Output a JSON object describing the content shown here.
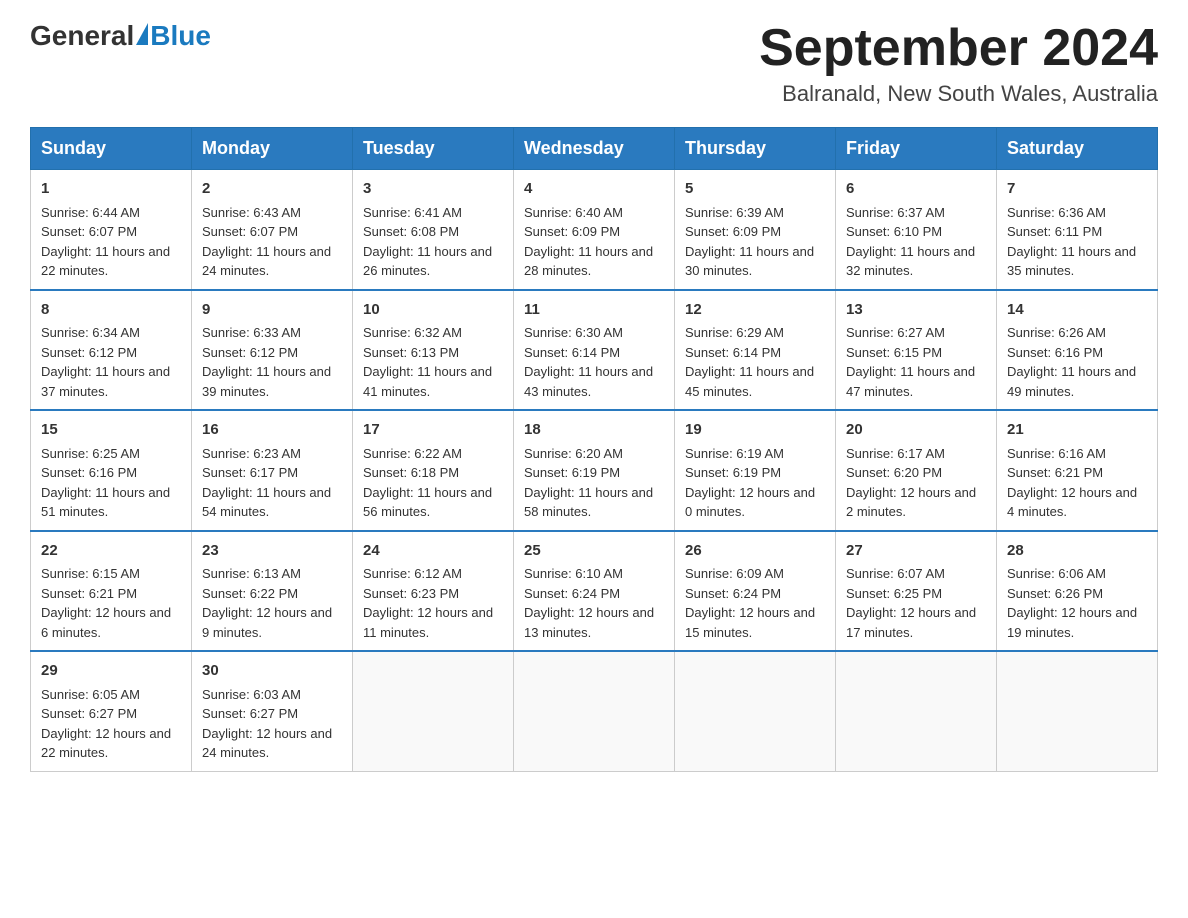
{
  "header": {
    "logo_general": "General",
    "logo_blue": "Blue",
    "month_title": "September 2024",
    "location": "Balranald, New South Wales, Australia"
  },
  "days_of_week": [
    "Sunday",
    "Monday",
    "Tuesday",
    "Wednesday",
    "Thursday",
    "Friday",
    "Saturday"
  ],
  "weeks": [
    [
      {
        "day": "1",
        "sunrise": "6:44 AM",
        "sunset": "6:07 PM",
        "daylight": "11 hours and 22 minutes."
      },
      {
        "day": "2",
        "sunrise": "6:43 AM",
        "sunset": "6:07 PM",
        "daylight": "11 hours and 24 minutes."
      },
      {
        "day": "3",
        "sunrise": "6:41 AM",
        "sunset": "6:08 PM",
        "daylight": "11 hours and 26 minutes."
      },
      {
        "day": "4",
        "sunrise": "6:40 AM",
        "sunset": "6:09 PM",
        "daylight": "11 hours and 28 minutes."
      },
      {
        "day": "5",
        "sunrise": "6:39 AM",
        "sunset": "6:09 PM",
        "daylight": "11 hours and 30 minutes."
      },
      {
        "day": "6",
        "sunrise": "6:37 AM",
        "sunset": "6:10 PM",
        "daylight": "11 hours and 32 minutes."
      },
      {
        "day": "7",
        "sunrise": "6:36 AM",
        "sunset": "6:11 PM",
        "daylight": "11 hours and 35 minutes."
      }
    ],
    [
      {
        "day": "8",
        "sunrise": "6:34 AM",
        "sunset": "6:12 PM",
        "daylight": "11 hours and 37 minutes."
      },
      {
        "day": "9",
        "sunrise": "6:33 AM",
        "sunset": "6:12 PM",
        "daylight": "11 hours and 39 minutes."
      },
      {
        "day": "10",
        "sunrise": "6:32 AM",
        "sunset": "6:13 PM",
        "daylight": "11 hours and 41 minutes."
      },
      {
        "day": "11",
        "sunrise": "6:30 AM",
        "sunset": "6:14 PM",
        "daylight": "11 hours and 43 minutes."
      },
      {
        "day": "12",
        "sunrise": "6:29 AM",
        "sunset": "6:14 PM",
        "daylight": "11 hours and 45 minutes."
      },
      {
        "day": "13",
        "sunrise": "6:27 AM",
        "sunset": "6:15 PM",
        "daylight": "11 hours and 47 minutes."
      },
      {
        "day": "14",
        "sunrise": "6:26 AM",
        "sunset": "6:16 PM",
        "daylight": "11 hours and 49 minutes."
      }
    ],
    [
      {
        "day": "15",
        "sunrise": "6:25 AM",
        "sunset": "6:16 PM",
        "daylight": "11 hours and 51 minutes."
      },
      {
        "day": "16",
        "sunrise": "6:23 AM",
        "sunset": "6:17 PM",
        "daylight": "11 hours and 54 minutes."
      },
      {
        "day": "17",
        "sunrise": "6:22 AM",
        "sunset": "6:18 PM",
        "daylight": "11 hours and 56 minutes."
      },
      {
        "day": "18",
        "sunrise": "6:20 AM",
        "sunset": "6:19 PM",
        "daylight": "11 hours and 58 minutes."
      },
      {
        "day": "19",
        "sunrise": "6:19 AM",
        "sunset": "6:19 PM",
        "daylight": "12 hours and 0 minutes."
      },
      {
        "day": "20",
        "sunrise": "6:17 AM",
        "sunset": "6:20 PM",
        "daylight": "12 hours and 2 minutes."
      },
      {
        "day": "21",
        "sunrise": "6:16 AM",
        "sunset": "6:21 PM",
        "daylight": "12 hours and 4 minutes."
      }
    ],
    [
      {
        "day": "22",
        "sunrise": "6:15 AM",
        "sunset": "6:21 PM",
        "daylight": "12 hours and 6 minutes."
      },
      {
        "day": "23",
        "sunrise": "6:13 AM",
        "sunset": "6:22 PM",
        "daylight": "12 hours and 9 minutes."
      },
      {
        "day": "24",
        "sunrise": "6:12 AM",
        "sunset": "6:23 PM",
        "daylight": "12 hours and 11 minutes."
      },
      {
        "day": "25",
        "sunrise": "6:10 AM",
        "sunset": "6:24 PM",
        "daylight": "12 hours and 13 minutes."
      },
      {
        "day": "26",
        "sunrise": "6:09 AM",
        "sunset": "6:24 PM",
        "daylight": "12 hours and 15 minutes."
      },
      {
        "day": "27",
        "sunrise": "6:07 AM",
        "sunset": "6:25 PM",
        "daylight": "12 hours and 17 minutes."
      },
      {
        "day": "28",
        "sunrise": "6:06 AM",
        "sunset": "6:26 PM",
        "daylight": "12 hours and 19 minutes."
      }
    ],
    [
      {
        "day": "29",
        "sunrise": "6:05 AM",
        "sunset": "6:27 PM",
        "daylight": "12 hours and 22 minutes."
      },
      {
        "day": "30",
        "sunrise": "6:03 AM",
        "sunset": "6:27 PM",
        "daylight": "12 hours and 24 minutes."
      },
      null,
      null,
      null,
      null,
      null
    ]
  ],
  "labels": {
    "sunrise": "Sunrise:",
    "sunset": "Sunset:",
    "daylight": "Daylight:"
  }
}
